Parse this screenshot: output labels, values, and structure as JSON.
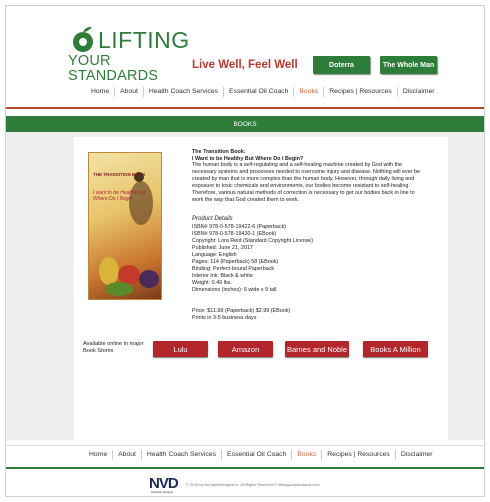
{
  "header": {
    "logo_line1": "LIFTING",
    "logo_line2": "YOUR STANDARDS",
    "tagline": "Live Well, Feel Well",
    "buttons": [
      "Doterra",
      "The Whole Man"
    ]
  },
  "nav": {
    "items": [
      "Home",
      "About",
      "Health Coach Services",
      "Essential Oil Coach",
      "Books",
      "Recipes | Resources",
      "Disclaimer"
    ],
    "active": "Books"
  },
  "section_title": "BOOKS",
  "book": {
    "cover_title": "THE TRANSITION BOOK",
    "cover_subtitle": "I want to be Healthy but Where Do I Begin",
    "title_line1": "The Transition Book:",
    "title_line2": "I Want to be Healthy But Where Do I Begin?",
    "description": "The human body is a self-regulating and a self-healing machine created by God with the necessary systems and processes needed to overcome injury and disease.  Nothing will ever be created by man that is more complex than the human body.  However, through daily living and exposure to toxic chemicals and environments, our bodies become resistant to self-healing.  Therefore, various natural methods of correction is necessary to get our bodies back in line to work the way that God created them to work.",
    "details_heading": "Product Details",
    "details": [
      "ISBN# 978-0-578-19422-6 (Paperback)",
      "ISBN# 978-0-578-19430-1 (EBook)",
      "Copyright:   Lora Reid (Standard Copyright License)",
      "Published:   June 21, 2017",
      "Language:   English",
      "Pages:   114 (Paperback)   58 (EBook)",
      "Binding:   Perfect-bound Paperback",
      "Interior Ink:   Black & white",
      "Weight:  0.49 lbs.",
      "Dimensions (inches):  6 wide x 9 tall"
    ],
    "price": "Price: $11.99 (Paperback) $2.99 (EBook)",
    "shipping": "Prints in 3-5 business days"
  },
  "stores": {
    "label": "Available online in major Book Stores",
    "buttons": [
      "Lulu",
      "Amazon",
      "Barnes and Noble",
      "Books A Million"
    ]
  },
  "footer": {
    "logo_text": "NVD",
    "logo_sub": "NuVision Designs",
    "copyright": "© 2018 by NuVisionDesignsInc. All Rights Reserved © liftingyourstandards.com"
  },
  "colors": {
    "brand_green": "#2e7d3a",
    "accent_red": "#b3262b",
    "active_nav": "#d4643a"
  }
}
